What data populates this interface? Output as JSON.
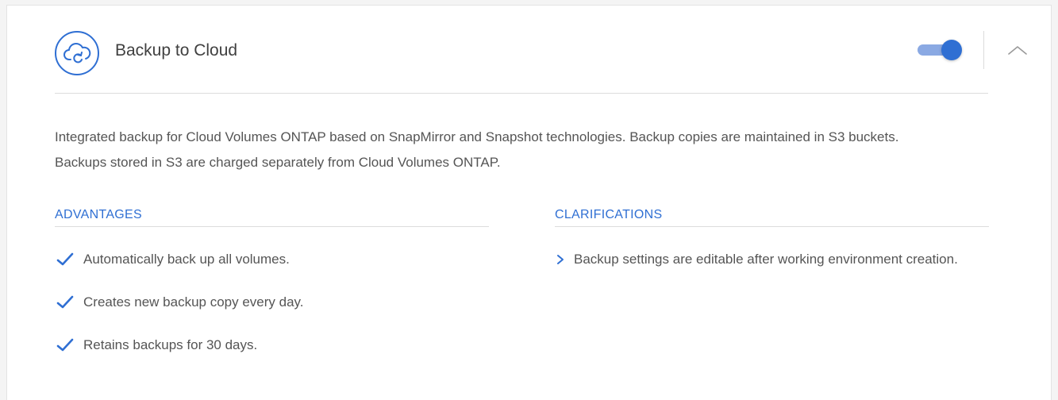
{
  "header": {
    "title": "Backup to Cloud",
    "icon": "cloud-backup-icon",
    "toggle_state": "on",
    "collapse_icon": "chevron-up-icon"
  },
  "description": "Integrated backup for Cloud Volumes ONTAP based on SnapMirror and Snapshot technologies. Backup copies are maintained in S3 buckets. Backups stored in S3 are charged separately from Cloud Volumes ONTAP.",
  "advantages": {
    "heading": "ADVANTAGES",
    "items": [
      "Automatically back up all volumes.",
      "Creates new backup copy every day.",
      "Retains backups for 30 days."
    ]
  },
  "clarifications": {
    "heading": "CLARIFICATIONS",
    "items": [
      "Backup settings are editable after working environment creation."
    ]
  },
  "colors": {
    "accent": "#2f6fd3",
    "toggle_track": "#8aa9e3",
    "text": "#555555",
    "divider": "#dcdcdc"
  }
}
